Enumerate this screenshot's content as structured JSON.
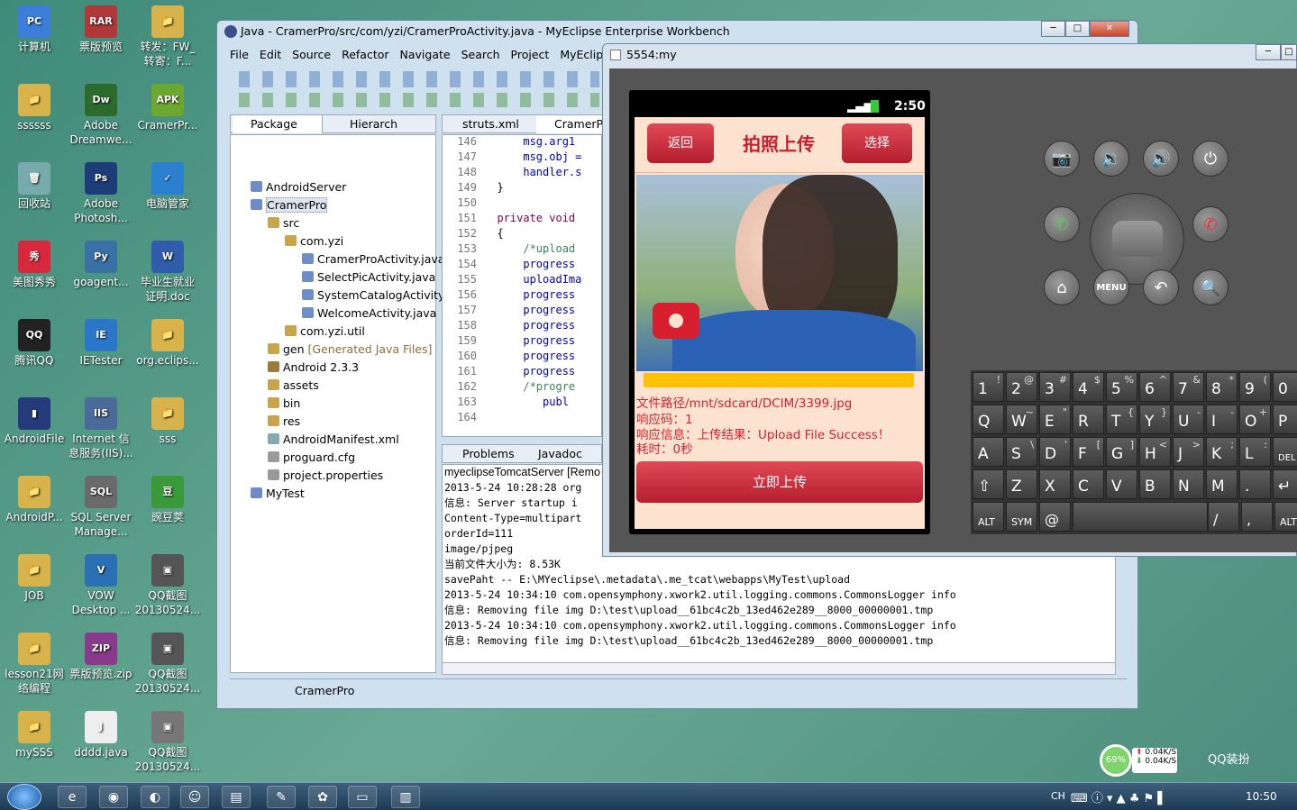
{
  "desktop": {
    "icons": [
      {
        "l": "计算机",
        "c": "#3b7dd8",
        "g": "PC"
      },
      {
        "l": "票版预览",
        "c": "#b03838",
        "g": "RAR"
      },
      {
        "l": "转发：FW_\n转寄：F...",
        "c": "#d8b24a",
        "g": "📁"
      },
      {
        "l": "ssssss",
        "c": "#d8b24a",
        "g": "📁"
      },
      {
        "l": "Adobe\nDreamwe...",
        "c": "#2c6b2c",
        "g": "Dw"
      },
      {
        "l": "CramerPr...",
        "c": "#6ca830",
        "g": "APK"
      },
      {
        "l": "回收站",
        "c": "#7aa",
        "g": "🗑"
      },
      {
        "l": "Adobe\nPhotosh...",
        "c": "#1d3d78",
        "g": "Ps"
      },
      {
        "l": "电脑管家",
        "c": "#2b7fcf",
        "g": "✓"
      },
      {
        "l": "美图秀秀",
        "c": "#d8283b",
        "g": "秀"
      },
      {
        "l": "goagent...",
        "c": "#3970a6",
        "g": "Py"
      },
      {
        "l": "毕业生就业\n证明.doc",
        "c": "#2f5cab",
        "g": "W"
      },
      {
        "l": "腾讯QQ",
        "c": "#222",
        "g": "QQ"
      },
      {
        "l": "IETester",
        "c": "#2a77c9",
        "g": "IE"
      },
      {
        "l": "org.eclips...",
        "c": "#d8b24a",
        "g": "📁"
      },
      {
        "l": "AndroidFile",
        "c": "#243a7a",
        "g": "▮"
      },
      {
        "l": "Internet 信\n息服务(IIS)...",
        "c": "#4a6a9a",
        "g": "IIS"
      },
      {
        "l": "sss",
        "c": "#d8b24a",
        "g": "📁"
      },
      {
        "l": "AndroidP...",
        "c": "#d8b24a",
        "g": "📁"
      },
      {
        "l": "SQL Server\nManage...",
        "c": "#6a6a6a",
        "g": "SQL"
      },
      {
        "l": "豌豆荚",
        "c": "#3a9a3a",
        "g": "豆"
      },
      {
        "l": "JOB",
        "c": "#d8b24a",
        "g": "📁"
      },
      {
        "l": "VOW\nDesktop ...",
        "c": "#2b6fb4",
        "g": "V"
      },
      {
        "l": "QQ截图\n20130524...",
        "c": "#555",
        "g": "▣"
      },
      {
        "l": "lesson21网\n络编程",
        "c": "#d8b24a",
        "g": "📁"
      },
      {
        "l": "票版预览.zip",
        "c": "#8a3a8a",
        "g": "ZIP"
      },
      {
        "l": "QQ截图\n20130524...",
        "c": "#555",
        "g": "▣"
      },
      {
        "l": "mySSS",
        "c": "#d8b24a",
        "g": "📁"
      },
      {
        "l": "dddd.java",
        "c": "#eee",
        "g": "J"
      },
      {
        "l": "QQ截图\n20130524...",
        "c": "#777",
        "g": "▣"
      }
    ]
  },
  "eclipse": {
    "title": "Java - CramerPro/src/com/yzi/CramerProActivity.java - MyEclipse Enterprise Workbench",
    "menu": [
      "File",
      "Edit",
      "Source",
      "Refactor",
      "Navigate",
      "Search",
      "Project",
      "MyEclipse"
    ],
    "tabs": {
      "package": "Package",
      "hierarchy": "Hierarch",
      "struts": "struts.xml",
      "cramer": "CramerP",
      "problems": "Problems",
      "javadoc": "Javadoc"
    },
    "tree": [
      {
        "t": "AndroidServer",
        "d": 0,
        "c": "#6b8cc7"
      },
      {
        "t": "CramerPro",
        "d": 0,
        "c": "#6b8cc7",
        "sel": true
      },
      {
        "t": "src",
        "d": 1,
        "c": "#c9a44b"
      },
      {
        "t": "com.yzi",
        "d": 2,
        "c": "#c9a44b"
      },
      {
        "t": "CramerProActivity.java",
        "d": 3,
        "c": "#6d8fc9"
      },
      {
        "t": "SelectPicActivity.java",
        "d": 3,
        "c": "#6d8fc9"
      },
      {
        "t": "SystemCatalogActivity",
        "d": 3,
        "c": "#6d8fc9"
      },
      {
        "t": "WelcomeActivity.java",
        "d": 3,
        "c": "#6d8fc9"
      },
      {
        "t": "com.yzi.util",
        "d": 2,
        "c": "#c9a44b"
      },
      {
        "t": "gen",
        "d": 1,
        "c": "#c9a44b",
        "extra": "[Generated Java Files]"
      },
      {
        "t": "Android 2.3.3",
        "d": 1,
        "c": "#9a7b3b"
      },
      {
        "t": "assets",
        "d": 1,
        "c": "#c9a44b"
      },
      {
        "t": "bin",
        "d": 1,
        "c": "#c9a44b"
      },
      {
        "t": "res",
        "d": 1,
        "c": "#c9a44b"
      },
      {
        "t": "AndroidManifest.xml",
        "d": 1,
        "c": "#8aa"
      },
      {
        "t": "proguard.cfg",
        "d": 1,
        "c": "#999"
      },
      {
        "t": "project.properties",
        "d": 1,
        "c": "#999"
      },
      {
        "t": "MyTest",
        "d": 0,
        "c": "#6b8cc7"
      }
    ],
    "code": [
      {
        "n": "146",
        "t": "      msg.arg1"
      },
      {
        "n": "147",
        "t": "      msg.obj ="
      },
      {
        "n": "148",
        "t": "      handler.s"
      },
      {
        "n": "149",
        "t": "  }"
      },
      {
        "n": "150",
        "t": ""
      },
      {
        "n": "151",
        "t": "  private void"
      },
      {
        "n": "152",
        "t": "  {"
      },
      {
        "n": "153",
        "t": "      /*upload"
      },
      {
        "n": "154",
        "t": "      progress"
      },
      {
        "n": "155",
        "t": "      uploadIma"
      },
      {
        "n": "156",
        "t": "      progress"
      },
      {
        "n": "157",
        "t": "      progress"
      },
      {
        "n": "158",
        "t": "      progress"
      },
      {
        "n": "159",
        "t": "      progress"
      },
      {
        "n": "160",
        "t": "      progress"
      },
      {
        "n": "161",
        "t": "      progress"
      },
      {
        "n": "162",
        "t": "      /*progre"
      },
      {
        "n": "163",
        "t": "         publ"
      },
      {
        "n": "164",
        "t": ""
      }
    ],
    "console_head": "myeclipseTomcatServer [Remo",
    "console": [
      "2013-5-24 10:28:28 org",
      "信息: Server startup i",
      "Content-Type=multipart",
      "orderId=111",
      "image/pjpeg",
      "当前文件大小为: 8.53K",
      "savePaht -- E:\\MYeclipse\\.metadata\\.me_tcat\\webapps\\MyTest\\upload",
      "2013-5-24 10:34:10 com.opensymphony.xwork2.util.logging.commons.CommonsLogger info",
      "信息: Removing file img D:\\test\\upload__61bc4c2b_13ed462e289__8000_00000001.tmp",
      "2013-5-24 10:34:10 com.opensymphony.xwork2.util.logging.commons.CommonsLogger info",
      "信息: Removing file img D:\\test\\upload__61bc4c2b_13ed462e289__8000_00000001.tmp"
    ],
    "status": "CramerPro"
  },
  "emulator": {
    "title": "5554:my",
    "time": "2:50",
    "back": "返回",
    "header": "拍照上传",
    "select": "选择",
    "path": "文件路径/mnt/sdcard/DCIM/3399.jpg",
    "code": "响应码：1",
    "info": "响应信息：上传结果：Upload File Success！",
    "elapsed": "耗时：0秒",
    "upload": "立即上传",
    "keys_row1": [
      {
        "m": "1",
        "s": "!"
      },
      {
        "m": "2",
        "s": "@"
      },
      {
        "m": "3",
        "s": "#"
      },
      {
        "m": "4",
        "s": "$"
      },
      {
        "m": "5",
        "s": "%"
      },
      {
        "m": "6",
        "s": "^"
      },
      {
        "m": "7",
        "s": "&"
      },
      {
        "m": "8",
        "s": "*"
      },
      {
        "m": "9",
        "s": "("
      },
      {
        "m": "0",
        "s": ")"
      }
    ],
    "keys_row2": [
      {
        "m": "Q",
        "s": ""
      },
      {
        "m": "W",
        "s": "~"
      },
      {
        "m": "E",
        "s": "\""
      },
      {
        "m": "R",
        "s": ""
      },
      {
        "m": "T",
        "s": "{"
      },
      {
        "m": "Y",
        "s": "}"
      },
      {
        "m": "U",
        "s": "-"
      },
      {
        "m": "I",
        "s": "-"
      },
      {
        "m": "O",
        "s": "+"
      },
      {
        "m": "P",
        "s": ""
      }
    ],
    "keys_row3": [
      {
        "m": "A",
        "s": ""
      },
      {
        "m": "S",
        "s": "\\"
      },
      {
        "m": "D",
        "s": "'"
      },
      {
        "m": "F",
        "s": "["
      },
      {
        "m": "G",
        "s": "]"
      },
      {
        "m": "H",
        "s": "<"
      },
      {
        "m": "J",
        "s": ">"
      },
      {
        "m": "K",
        "s": ";"
      },
      {
        "m": "L",
        "s": ":"
      },
      {
        "m": "DEL",
        "s": ""
      }
    ],
    "keys_row4": [
      {
        "m": "⇧",
        "s": ""
      },
      {
        "m": "Z",
        "s": ""
      },
      {
        "m": "X",
        "s": ""
      },
      {
        "m": "C",
        "s": ""
      },
      {
        "m": "V",
        "s": ""
      },
      {
        "m": "B",
        "s": ""
      },
      {
        "m": "N",
        "s": ""
      },
      {
        "m": "M",
        "s": ""
      },
      {
        "m": ".",
        "s": ""
      },
      {
        "m": "↵",
        "s": ""
      }
    ],
    "keys_row5": {
      "alt": "ALT",
      "sym": "SYM",
      "at": "@",
      "slash": "/",
      "comma": ",",
      "alt2": "ALT"
    },
    "menu_label": "MENU"
  },
  "netmeter": {
    "pct": "69%",
    "up": "0.04K/S",
    "down": "0.04K/S",
    "brand": "QQ装扮"
  },
  "tray": {
    "lang": "CH",
    "time": "10:50"
  }
}
